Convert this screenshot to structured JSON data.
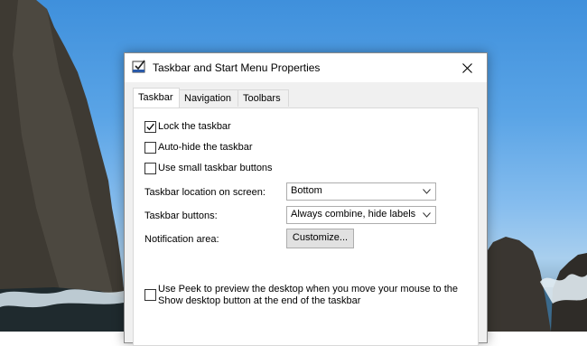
{
  "dialog": {
    "title": "Taskbar and Start Menu Properties",
    "close_icon": "close-icon"
  },
  "tabs": [
    {
      "label": "Taskbar",
      "active": true
    },
    {
      "label": "Navigation",
      "active": false
    },
    {
      "label": "Toolbars",
      "active": false
    }
  ],
  "options": {
    "lock_taskbar": {
      "label": "Lock the taskbar",
      "checked": true
    },
    "auto_hide": {
      "label": "Auto-hide the taskbar",
      "checked": false
    },
    "small_buttons": {
      "label": "Use small taskbar buttons",
      "checked": false
    },
    "peek": {
      "label_line1": "Use Peek to preview the desktop when you move your mouse to the",
      "label_line2": "Show desktop button at the end of the taskbar",
      "checked": false
    }
  },
  "settings": {
    "location": {
      "label": "Taskbar location on screen:",
      "value": "Bottom"
    },
    "buttons": {
      "label": "Taskbar buttons:",
      "value": "Always combine, hide labels"
    },
    "notification": {
      "label": "Notification area:",
      "button_label": "Customize..."
    }
  },
  "colors": {
    "highlight": "#e8402c",
    "dialog_bg": "#f0f0f0"
  }
}
